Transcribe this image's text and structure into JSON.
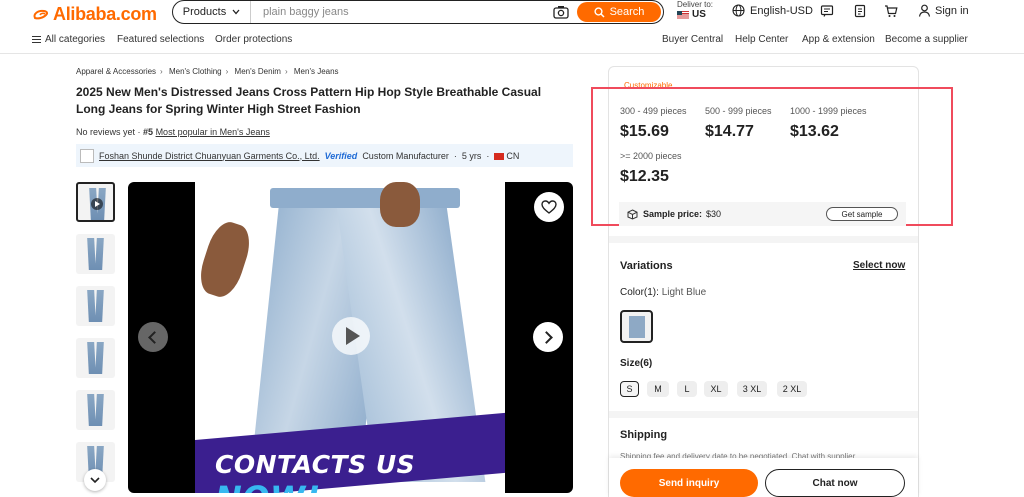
{
  "header": {
    "logo_text": "Alibaba.com",
    "search": {
      "category": "Products",
      "value": "plain baggy jeans",
      "button": "Search"
    },
    "deliver_to": {
      "label": "Deliver to:",
      "country": "US"
    },
    "language": "English-USD",
    "sign_in": "Sign in"
  },
  "subnav": {
    "left": [
      "All categories",
      "Featured selections",
      "Order protections"
    ],
    "right": [
      "Buyer Central",
      "Help Center",
      "App & extension",
      "Become a supplier"
    ]
  },
  "breadcrumb": [
    "Apparel & Accessories",
    "Men's Clothing",
    "Men's Denim",
    "Men's Jeans"
  ],
  "product": {
    "title": "2025 New Men's Distressed Jeans Cross Pattern Hip Hop Style Breathable Casual Long Jeans for Spring Winter High Street Fashion",
    "reviews": "No reviews yet",
    "rank": "#5",
    "rank_link": "Most popular in Men's Jeans",
    "supplier": {
      "name": "Foshan Shunde District Chuanyuan Garments Co., Ltd.",
      "verified": "Verified",
      "type": "Custom Manufacturer",
      "years": "5 yrs",
      "country": "CN"
    },
    "banner": {
      "text": "CONTACTS US",
      "highlight": "NOW!"
    }
  },
  "pricing": {
    "customizable": "Customizable",
    "tiers": [
      {
        "qty": "300 - 499 pieces",
        "price": "$15.69"
      },
      {
        "qty": "500 - 999 pieces",
        "price": "$14.77"
      },
      {
        "qty": "1000 - 1999 pieces",
        "price": "$13.62"
      },
      {
        "qty": ">= 2000 pieces",
        "price": "$12.35"
      }
    ],
    "sample_label": "Sample price:",
    "sample_price": "$30",
    "get_sample": "Get sample"
  },
  "variations": {
    "title": "Variations",
    "select_now": "Select now",
    "color_label": "Color(1):",
    "color_value": "Light Blue",
    "size_label": "Size(6)",
    "sizes": [
      "S",
      "M",
      "L",
      "XL",
      "3 XL",
      "2 XL"
    ]
  },
  "shipping": {
    "title": "Shipping",
    "text": "Shipping fee and delivery date to be negotiated. Chat with supplier"
  },
  "actions": {
    "send_inquiry": "Send inquiry",
    "chat_now": "Chat now"
  },
  "colors": {
    "brand": "#ff6a00",
    "highlight_box": "#f04b5c",
    "verified": "#1f6bd6"
  }
}
